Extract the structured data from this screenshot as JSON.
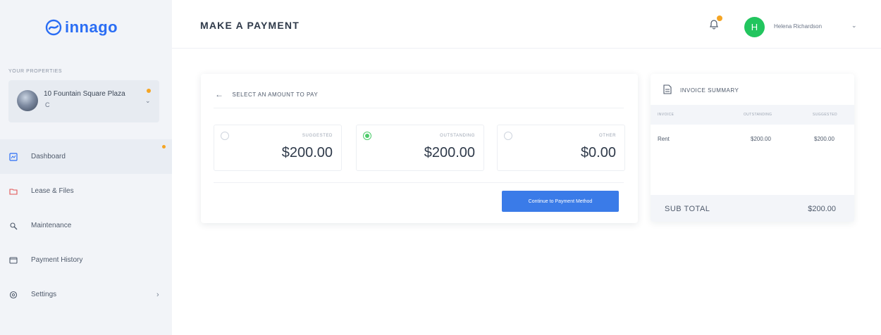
{
  "app": {
    "logo_text": "innago",
    "brand_color": "#2a6df4",
    "accent_color": "#f5a524"
  },
  "sidebar": {
    "properties_label": "YOUR PROPERTIES",
    "property": {
      "name": "10 Fountain Square Plaza",
      "sub": "C"
    },
    "items": [
      {
        "label": "Dashboard",
        "icon": "dashboard-icon",
        "active": true,
        "notification": true
      },
      {
        "label": "Lease & Files",
        "icon": "folder-icon"
      },
      {
        "label": "Maintenance",
        "icon": "wrench-icon"
      },
      {
        "label": "Payment History",
        "icon": "wallet-icon"
      },
      {
        "label": "Settings",
        "icon": "gear-icon",
        "chevron": "›"
      }
    ]
  },
  "header": {
    "title": "MAKE A PAYMENT",
    "bell_icon": "bell-icon",
    "avatar_initial": "H",
    "avatar_color": "#22c55e",
    "user_name": "Helena Richardson",
    "user_caret": "⌄"
  },
  "payment": {
    "heading": "SELECT AN AMOUNT TO PAY",
    "back_icon": "arrow-left-icon",
    "options": [
      {
        "label": "SUGGESTED",
        "amount": "$200.00",
        "selected": false
      },
      {
        "label": "OUTSTANDING",
        "amount": "$200.00",
        "selected": true
      },
      {
        "label": "OTHER",
        "amount": "$0.00",
        "selected": false
      }
    ],
    "continue_label": "Continue to Payment Method",
    "button_color": "#3a7be8"
  },
  "invoice": {
    "heading": "INVOICE SUMMARY",
    "icon": "document-icon",
    "columns": [
      "INVOICE",
      "OUTSTANDING",
      "SUGGESTED"
    ],
    "rows": [
      {
        "invoice": "Rent",
        "outstanding": "$200.00",
        "suggested": "$200.00"
      }
    ],
    "subtotal_label": "SUB TOTAL",
    "subtotal_value": "$200.00"
  }
}
